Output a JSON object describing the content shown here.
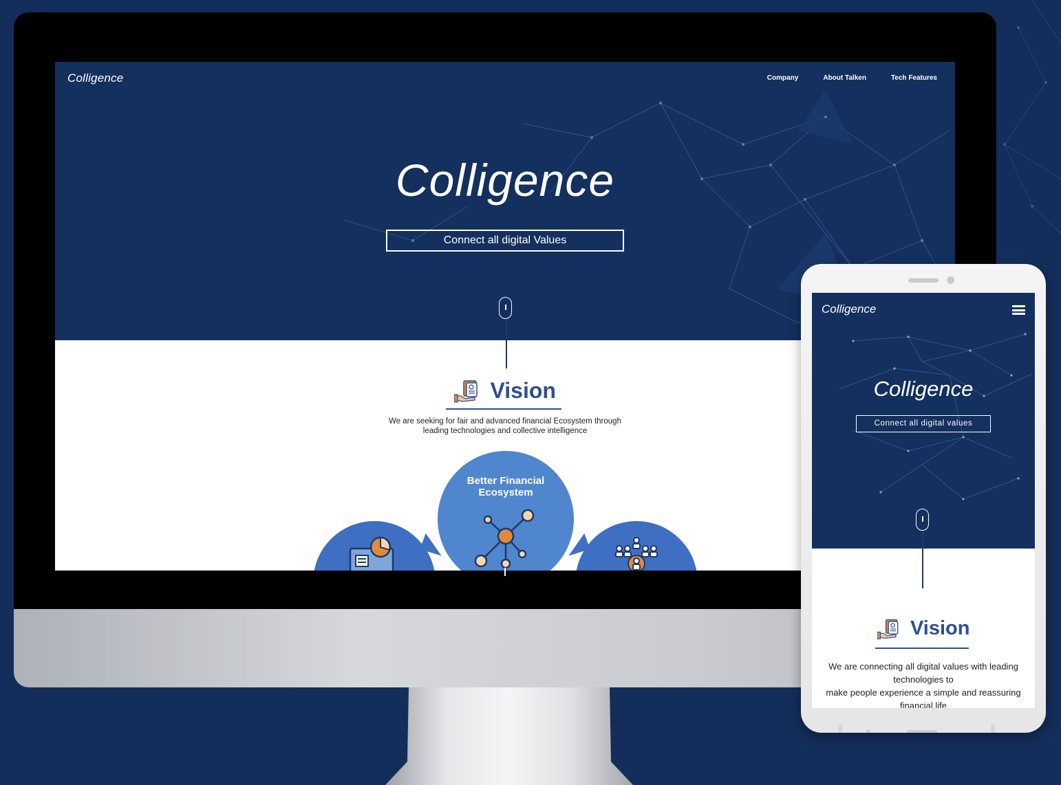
{
  "desktop": {
    "nav": {
      "logo": "Colligence",
      "links": [
        "Company",
        "About Talken",
        "Tech Features"
      ]
    },
    "hero": {
      "title": "Colligence",
      "button_label": "Connect all digital Values"
    },
    "vision": {
      "title": "Vision",
      "description_lines": [
        "We are seeking for fair and advanced financial Ecosystem through",
        "leading technologies and collective intelligence"
      ]
    },
    "circles": {
      "center_title_lines": [
        "Better Financial",
        "Ecosystem"
      ]
    }
  },
  "mobile": {
    "logo": "Colligence",
    "hero": {
      "title": "Colligence",
      "button_label": "Connect all digital values"
    },
    "vision": {
      "title": "Vision",
      "description_lines": [
        "We are connecting all digital values with leading",
        "technologies to",
        "make people experience a simple and reassuring",
        "financial life"
      ]
    }
  },
  "colors": {
    "background": "#142e5b",
    "hero_navy": "#13305e",
    "vision_blue": "#2f4f8f",
    "circle_light": "#4f86cd",
    "circle_dark": "#3f6fc2",
    "accent_orange": "#e08a3e"
  }
}
